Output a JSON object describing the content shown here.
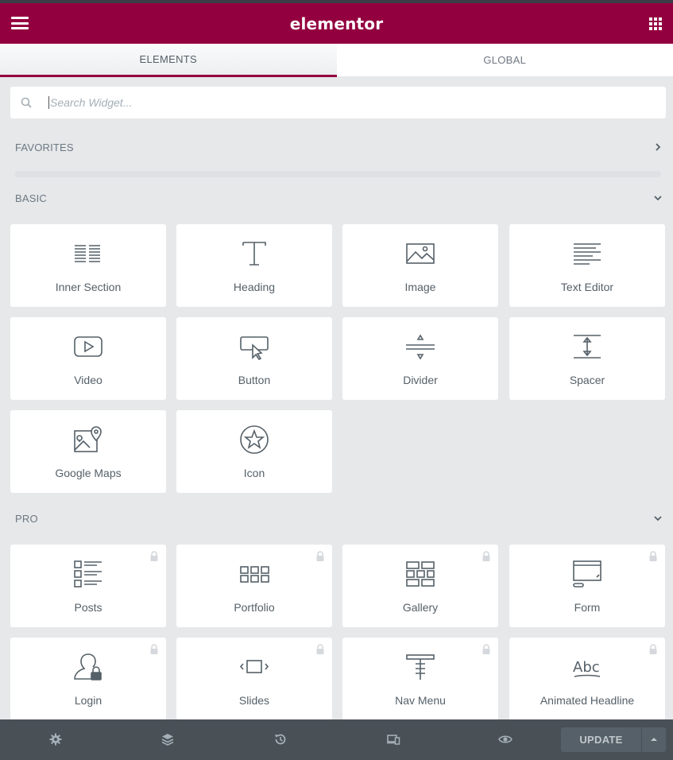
{
  "header": {
    "title": "elementor"
  },
  "tabs": [
    {
      "label": "ELEMENTS"
    },
    {
      "label": "GLOBAL"
    }
  ],
  "search": {
    "placeholder": "Search Widget..."
  },
  "sections": {
    "favorites": "FAVORITES",
    "basic": "BASIC",
    "pro": "PRO"
  },
  "basic_widgets": [
    {
      "label": "Inner Section",
      "icon": "inner-section-icon"
    },
    {
      "label": "Heading",
      "icon": "heading-icon"
    },
    {
      "label": "Image",
      "icon": "image-icon"
    },
    {
      "label": "Text Editor",
      "icon": "text-editor-icon"
    },
    {
      "label": "Video",
      "icon": "video-icon"
    },
    {
      "label": "Button",
      "icon": "button-icon"
    },
    {
      "label": "Divider",
      "icon": "divider-icon"
    },
    {
      "label": "Spacer",
      "icon": "spacer-icon"
    },
    {
      "label": "Google Maps",
      "icon": "google-maps-icon"
    },
    {
      "label": "Icon",
      "icon": "star-icon"
    }
  ],
  "pro_widgets": [
    {
      "label": "Posts",
      "icon": "posts-icon",
      "locked": true
    },
    {
      "label": "Portfolio",
      "icon": "portfolio-icon",
      "locked": true
    },
    {
      "label": "Gallery",
      "icon": "gallery-icon",
      "locked": true
    },
    {
      "label": "Form",
      "icon": "form-icon",
      "locked": true
    },
    {
      "label": "Login",
      "icon": "login-icon",
      "locked": true
    },
    {
      "label": "Slides",
      "icon": "slides-icon",
      "locked": true
    },
    {
      "label": "Nav Menu",
      "icon": "nav-menu-icon",
      "locked": true
    },
    {
      "label": "Animated Headline",
      "icon": "animated-headline-icon",
      "locked": true
    }
  ],
  "footer": {
    "buttons": [
      "settings-icon",
      "navigator-icon",
      "history-icon",
      "responsive-icon",
      "preview-icon"
    ],
    "update_label": "UPDATE"
  },
  "colors": {
    "brand": "#93003f",
    "footer": "#495157",
    "panel_bg": "#e6e8ea"
  }
}
